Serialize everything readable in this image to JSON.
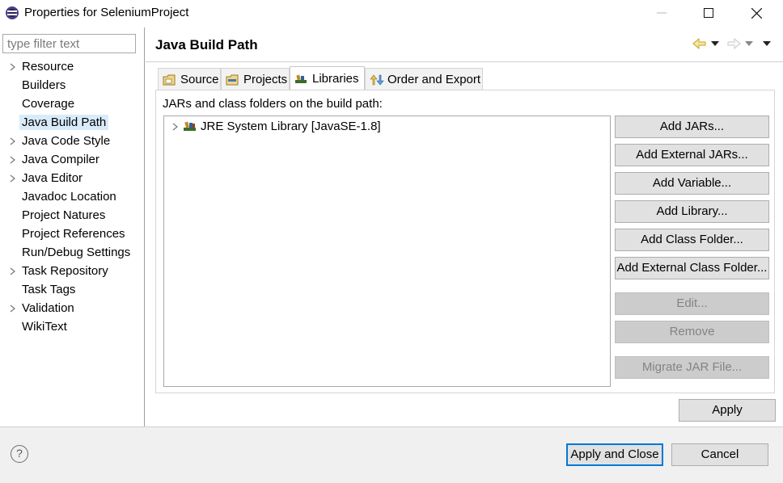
{
  "window": {
    "title": "Properties for SeleniumProject"
  },
  "filter": {
    "placeholder": "type filter text"
  },
  "sidebar": {
    "items": [
      {
        "label": "Resource",
        "expandable": true
      },
      {
        "label": "Builders",
        "expandable": false
      },
      {
        "label": "Coverage",
        "expandable": false
      },
      {
        "label": "Java Build Path",
        "expandable": false,
        "selected": true
      },
      {
        "label": "Java Code Style",
        "expandable": true
      },
      {
        "label": "Java Compiler",
        "expandable": true
      },
      {
        "label": "Java Editor",
        "expandable": true
      },
      {
        "label": "Javadoc Location",
        "expandable": false
      },
      {
        "label": "Project Natures",
        "expandable": false
      },
      {
        "label": "Project References",
        "expandable": false
      },
      {
        "label": "Run/Debug Settings",
        "expandable": false
      },
      {
        "label": "Task Repository",
        "expandable": true
      },
      {
        "label": "Task Tags",
        "expandable": false
      },
      {
        "label": "Validation",
        "expandable": true
      },
      {
        "label": "WikiText",
        "expandable": false
      }
    ]
  },
  "page": {
    "title": "Java Build Path"
  },
  "tabs": [
    {
      "label": "Source",
      "icon": "source-folder-icon"
    },
    {
      "label": "Projects",
      "icon": "projects-folder-icon"
    },
    {
      "label": "Libraries",
      "icon": "libraries-icon",
      "active": true
    },
    {
      "label": "Order and Export",
      "icon": "order-export-icon"
    }
  ],
  "libraries": {
    "heading": "JARs and class folders on the build path:",
    "entries": [
      {
        "label": "JRE System Library [JavaSE-1.8]",
        "icon": "library-icon"
      }
    ],
    "buttons": [
      {
        "label": "Add JARs...",
        "enabled": true
      },
      {
        "label": "Add External JARs...",
        "enabled": true
      },
      {
        "label": "Add Variable...",
        "enabled": true
      },
      {
        "label": "Add Library...",
        "enabled": true
      },
      {
        "label": "Add Class Folder...",
        "enabled": true
      },
      {
        "label": "Add External Class Folder...",
        "enabled": true
      },
      {
        "label": "Edit...",
        "enabled": false
      },
      {
        "label": "Remove",
        "enabled": false
      },
      {
        "label": "Migrate JAR File...",
        "enabled": false
      }
    ]
  },
  "apply": {
    "label": "Apply"
  },
  "footer": {
    "apply_close_label": "Apply and Close",
    "cancel_label": "Cancel",
    "help_glyph": "?"
  },
  "colors": {
    "selection": "#d9ebf9",
    "default_button_border": "#0078d7",
    "button_bg": "#e1e1e1",
    "disabled_button_bg": "#cccccc"
  }
}
